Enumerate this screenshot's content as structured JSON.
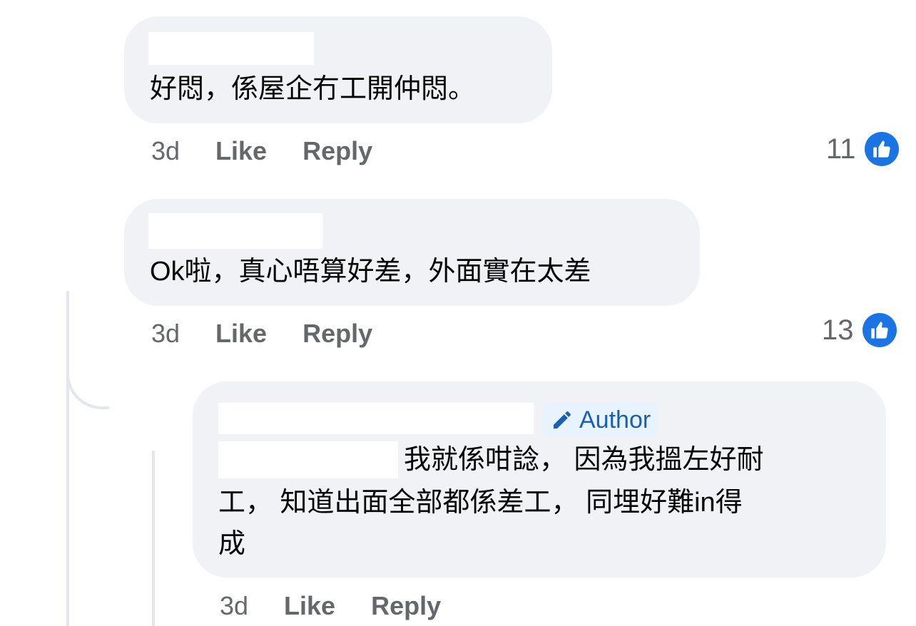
{
  "comments": [
    {
      "text": "好悶，係屋企冇工開仲悶。",
      "time": "3d",
      "like_label": "Like",
      "reply_label": "Reply",
      "reaction_count": "11"
    },
    {
      "text": "Ok啦，真心唔算好差，外面實在太差",
      "time": "3d",
      "like_label": "Like",
      "reply_label": "Reply",
      "reaction_count": "13"
    },
    {
      "badge": "Author",
      "lines": [
        "我就係咁諗， 因為我搵左好耐",
        "工， 知道出面全部都係差工， 同埋好難in得",
        "成"
      ],
      "time": "3d",
      "like_label": "Like",
      "reply_label": "Reply"
    }
  ],
  "colors": {
    "bubble": "#f0f2f5",
    "like_badge": "#1b74e4",
    "author_badge_bg": "#e7f3ff",
    "author_badge_text": "#1b5fb3",
    "meta_text": "#65676b"
  },
  "icons": [
    "thumbs-up-icon",
    "pencil-icon"
  ]
}
